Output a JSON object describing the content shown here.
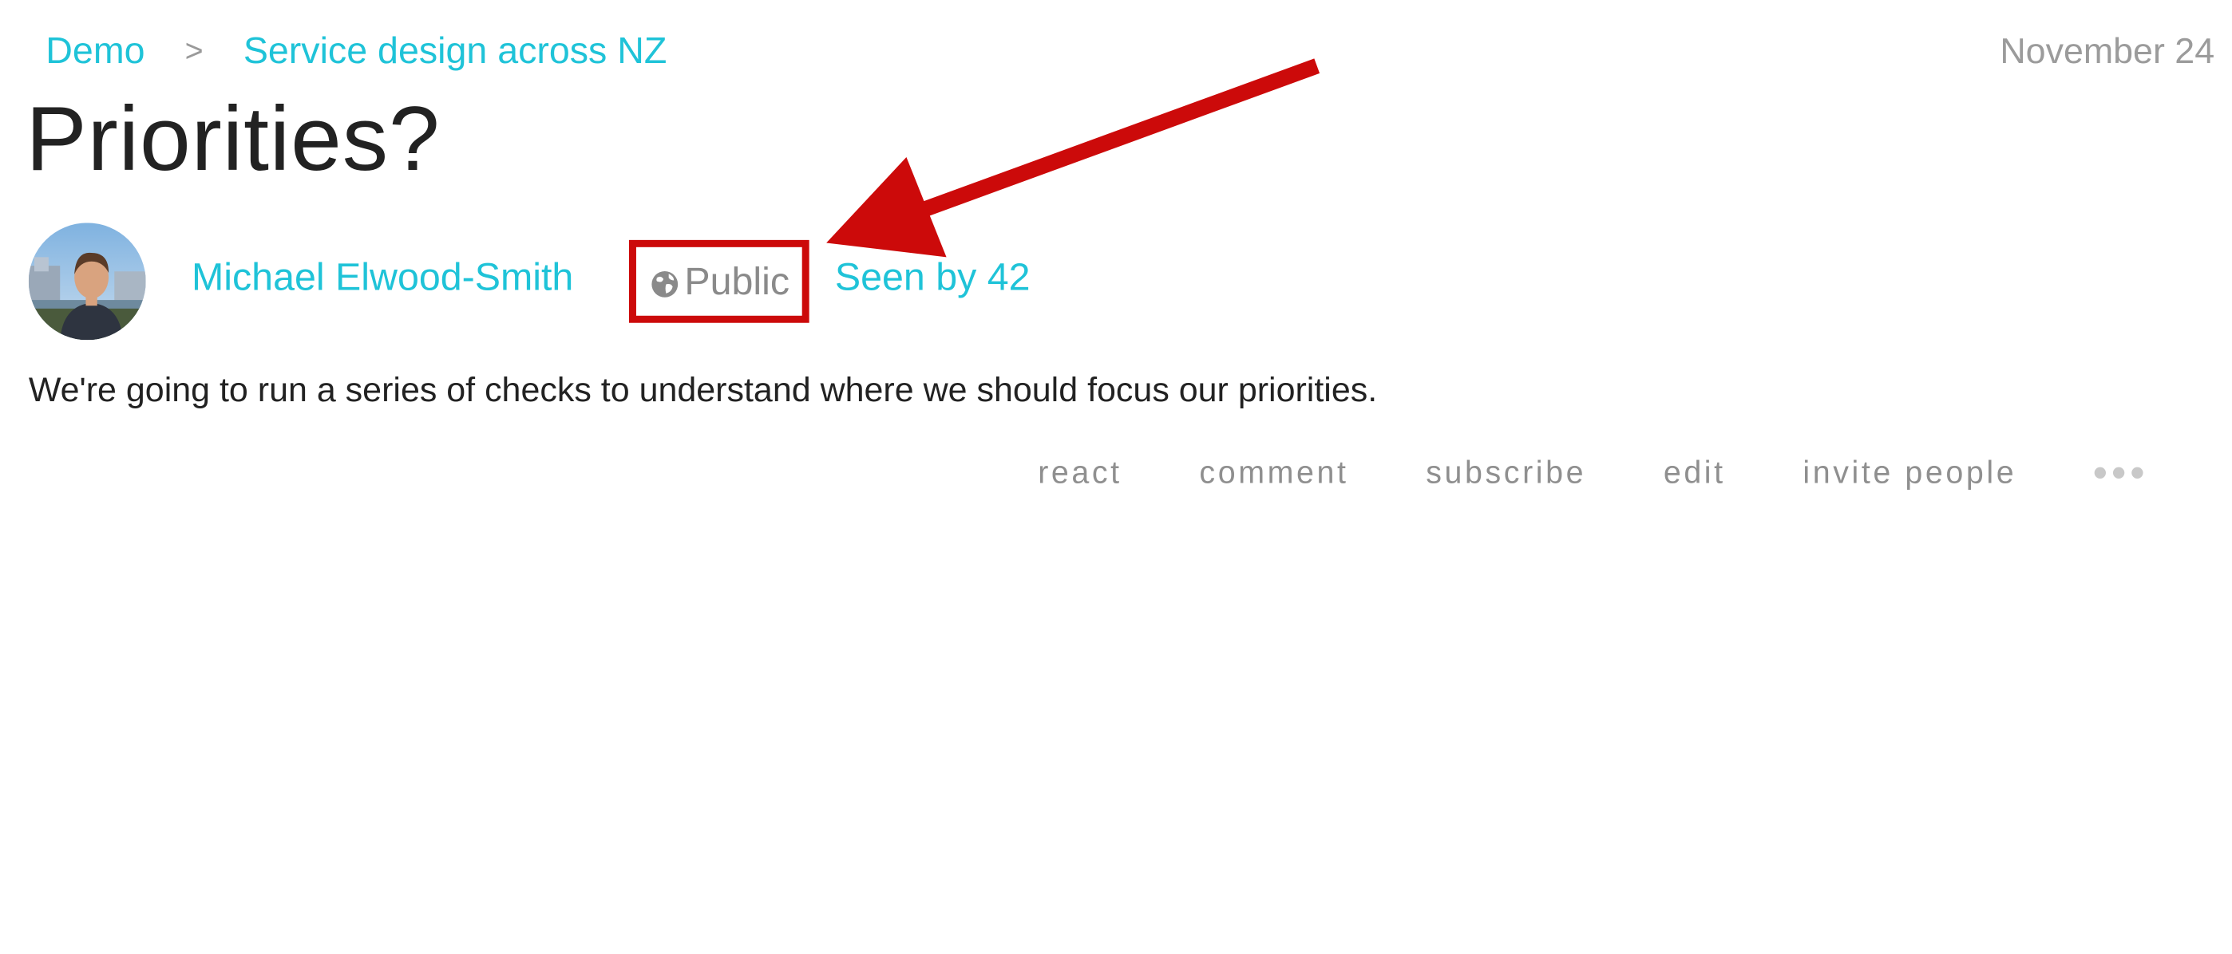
{
  "breadcrumb": {
    "items": [
      "Demo",
      "Service design across NZ"
    ],
    "separator": ">"
  },
  "post": {
    "date": "November 24",
    "title": "Priorities?",
    "author": "Michael Elwood-Smith",
    "visibility": "Public",
    "seen_by": "Seen by 42",
    "body": "We're going to run a series of checks to understand where we should focus our priorities."
  },
  "actions": {
    "react": "react",
    "comment": "comment",
    "subscribe": "subscribe",
    "edit": "edit",
    "invite": "invite people"
  },
  "icons": {
    "visibility": "globe-icon",
    "more": "more-horizontal-icon"
  },
  "colors": {
    "link": "#1fc3d8",
    "annotation": "#cc0a0a",
    "muted": "#8f8f8f",
    "text": "#222222"
  }
}
